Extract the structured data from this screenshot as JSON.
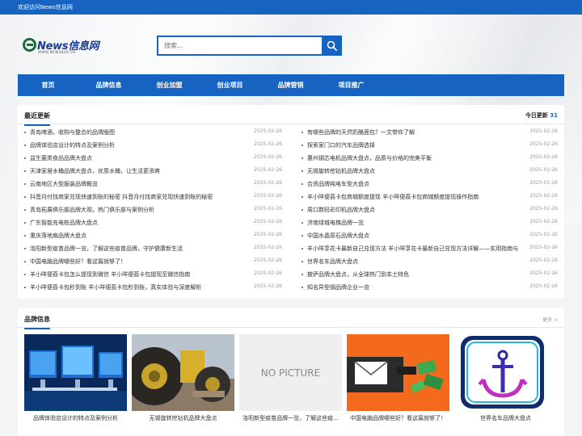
{
  "topbar": {
    "welcome": "欢迎访问News信息网"
  },
  "logo": {
    "brand": "News",
    "brand_cn": "信息网",
    "sub": "WWW.NEWSB2B.CN"
  },
  "search": {
    "placeholder": "搜索..."
  },
  "nav": [
    "首页",
    "品牌信息",
    "创业加盟",
    "创业项目",
    "品牌营销",
    "项目推广"
  ],
  "recent": {
    "title": "最近更新",
    "today_label": "今日更新",
    "today_count": "31",
    "left": [
      {
        "title": "青岛啤酒，收购与整合的品牌版图",
        "date": "2025-02-26"
      },
      {
        "title": "品牌体验店设计的特点及案例分析",
        "date": "2025-02-26"
      },
      {
        "title": "益生菌类食品品牌大盘点",
        "date": "2025-02-26"
      },
      {
        "title": "天津家居水桶品牌大盘点，优质水桶，让生活更添爽",
        "date": "2025-02-26"
      },
      {
        "title": "云南地区大型服装品牌概览",
        "date": "2025-02-26"
      },
      {
        "title": "抖音月付找商家兑现快速到账的秘密 抖音月付找商家兑现快速到账的秘密",
        "date": "2025-02-26"
      },
      {
        "title": "青岛拓展俱乐部品牌大观，热门俱乐部与案例分析",
        "date": "2025-02-26"
      },
      {
        "title": "广东智能充电桩品牌大盘点",
        "date": "2025-02-26"
      },
      {
        "title": "重庆落地扇品牌大盘点",
        "date": "2025-02-26"
      },
      {
        "title": "洛阳新型疫苗品牌一览，了解这些疫苗品牌，守护健康新生活",
        "date": "2025-02-26"
      },
      {
        "title": "中国电脑品牌哪些好？看这篇就够了！",
        "date": "2025-02-26"
      },
      {
        "title": "羊小咩便荔卡包怎么提现到微信 羊小咩便荔卡包提现至微信指南",
        "date": "2025-02-26"
      },
      {
        "title": "羊小咩便荔卡包秒到账 羊小咩便荔卡包秒到账，真实体验与深度解析",
        "date": "2025-02-26"
      }
    ],
    "right": [
      {
        "title": "有哪些品牌的天然奶酪面包？一文带你了解",
        "date": "2025-02-26"
      },
      {
        "title": "探索家门口的汽车品牌选择",
        "date": "2025-02-26"
      },
      {
        "title": "惠州钢芯电机品牌大盘点，品质与价格的完美平衡",
        "date": "2025-02-26"
      },
      {
        "title": "无锡旋转挖钻机品牌大盘点",
        "date": "2025-02-26"
      },
      {
        "title": "合资品牌纯电车型大盘点",
        "date": "2025-02-26"
      },
      {
        "title": "羊小咩便荔卡包商城额度提现 羊小咩便荔卡包商城额度提现操作指南",
        "date": "2025-02-26"
      },
      {
        "title": "周口数码彩印机品牌大盘点",
        "date": "2025-02-26"
      },
      {
        "title": "济南绿城电梯品牌一览",
        "date": "2025-02-26"
      },
      {
        "title": "中国水晶原石品牌大盘点",
        "date": "2025-02-26"
      },
      {
        "title": "羊小咩享花卡最新自己兑现方法 羊小咩享花卡最新自己兑现方法详解——实用指南与",
        "date": "2025-02-26"
      },
      {
        "title": "世界名车品牌大盘点",
        "date": "2025-02-26"
      },
      {
        "title": "披萨品牌大盘点，从全球热门到本土特色",
        "date": "2025-02-26"
      },
      {
        "title": "知名异型钢品牌企业一览",
        "date": "2025-02-26"
      }
    ]
  },
  "brand": {
    "title": "品牌信息",
    "more": "更多 >",
    "nopic": "NO PICTURE",
    "cards": [
      {
        "caption": "品牌体验店设计的特点及案例分析"
      },
      {
        "caption": "无锡旋转挖钻机品牌大盘点"
      },
      {
        "caption": "洛阳新型疫苗品牌一览，了解这些疫..."
      },
      {
        "caption": "中国电脑品牌哪些好？看这篇就够了！"
      },
      {
        "caption": "世界名车品牌大盘点"
      }
    ]
  },
  "colors": {
    "primary": "#1663c2",
    "background": "#f3f4f6"
  }
}
